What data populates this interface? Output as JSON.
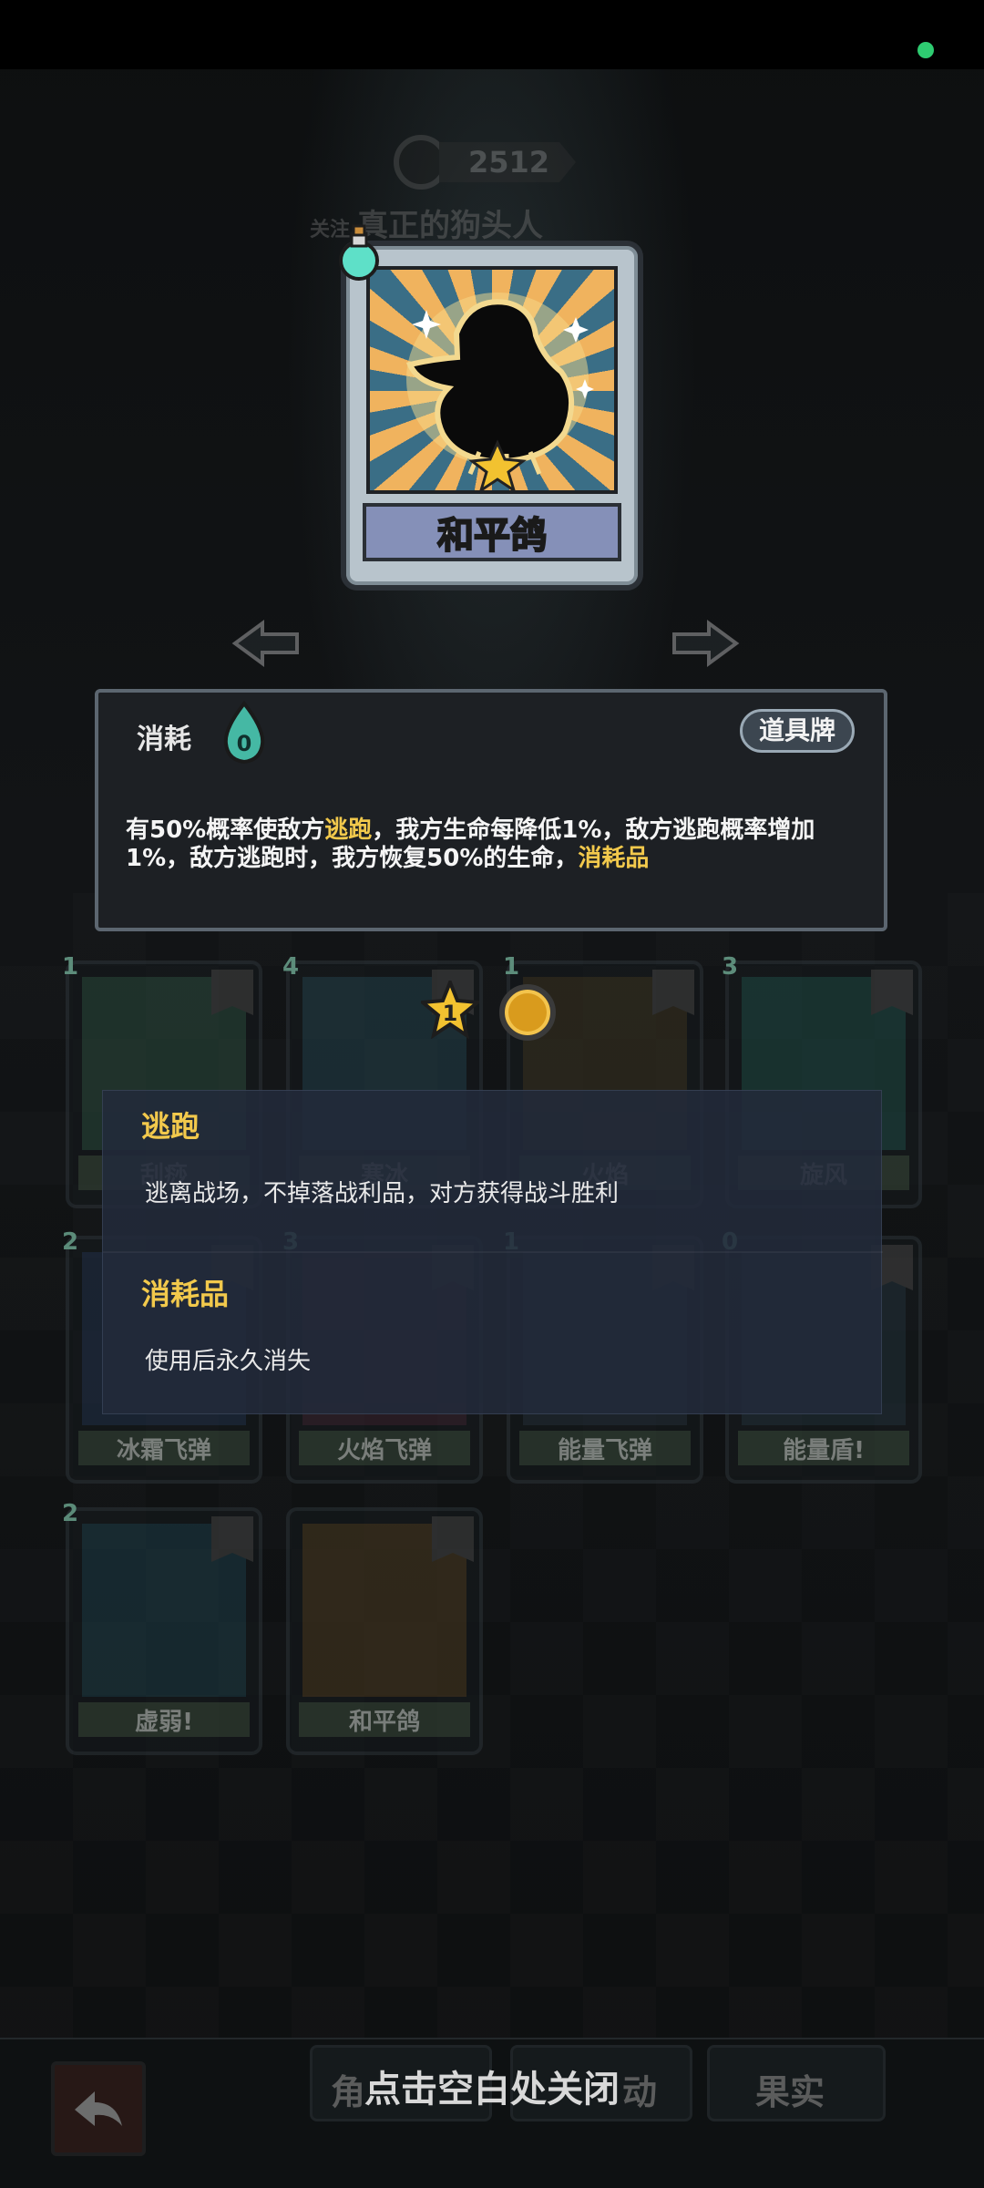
{
  "header": {
    "score": "2512",
    "dim_prefix": "关注",
    "dim_title": "真正的狗头人"
  },
  "card": {
    "name": "和平鸽",
    "type": "消耗",
    "cost": "0",
    "badge": "道具牌",
    "description_parts": [
      "有50%概率使敌方",
      "逃跑",
      "，我方生命每降低1%，敌方逃跑概率增加1%，敌方逃跑时，我方恢复50%的生命，",
      "消耗品"
    ]
  },
  "level": {
    "star": "1"
  },
  "deck": [
    {
      "name": "刮痧",
      "cost": "1",
      "art_color": "#2a4a3c"
    },
    {
      "name": "寒冰",
      "cost": "4",
      "art_color": "#23404a"
    },
    {
      "name": "火焰",
      "cost": "1",
      "art_color": "#3a3320"
    },
    {
      "name": "旋风",
      "cost": "3",
      "art_color": "#1e4a44"
    },
    {
      "name": "冰霜飞弹",
      "cost": "2",
      "art_color": "#22314a"
    },
    {
      "name": "火焰飞弹",
      "cost": "3",
      "art_color": "#3a2430"
    },
    {
      "name": "能量飞弹",
      "cost": "1",
      "art_color": "#24303a"
    },
    {
      "name": "能量盾!",
      "cost": "0",
      "art_color": "#22323a"
    },
    {
      "name": "虚弱!",
      "cost": "2",
      "art_color": "#1d3c46"
    },
    {
      "name": "和平鸽",
      "cost": "",
      "art_color": "#4a3a20"
    }
  ],
  "tooltip": {
    "items": [
      {
        "title": "逃跑",
        "body": "逃离战场，不掉落战利品，对方获得战斗胜利"
      },
      {
        "title": "消耗品",
        "body": "使用后永久消失"
      }
    ]
  },
  "bottom": {
    "close_hint": "点击空白处关闭",
    "btn_left": "角",
    "btn_mid": "动",
    "btn_right": "果实"
  }
}
